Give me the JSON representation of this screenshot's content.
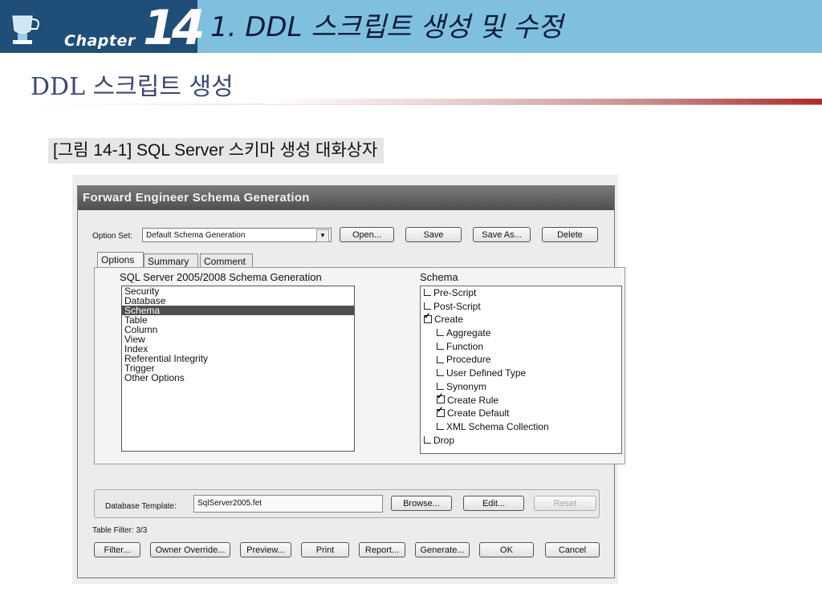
{
  "header": {
    "chapter_label": "Chapter",
    "chapter_number": "14",
    "title": "1. DDL 스크립트 생성 및 수정",
    "logo_icon": "trophy-icon"
  },
  "section_title": "DDL 스크립트 생성",
  "figure_caption": "[그림 14-1] SQL Server 스키마 생성 대화상자",
  "dialog": {
    "title": "Forward Engineer Schema Generation",
    "option_set_label": "Option Set:",
    "option_set_value": "Default Schema Generation",
    "buttons_top": [
      "Open...",
      "Save",
      "Save As...",
      "Delete"
    ],
    "tabs": [
      "Options",
      "Summary",
      "Comment"
    ],
    "active_tab": "Options",
    "left_heading": "SQL Server 2005/2008 Schema Generation",
    "left_items": [
      "Security",
      "Database",
      "Schema",
      "Table",
      "Column",
      "View",
      "Index",
      "Referential Integrity",
      "Trigger",
      "Other Options"
    ],
    "left_selected": "Schema",
    "right_heading": "Schema",
    "tree": [
      {
        "label": "Pre-Script",
        "checked": false,
        "level": 0
      },
      {
        "label": "Post-Script",
        "checked": false,
        "level": 0
      },
      {
        "label": "Create",
        "checked": true,
        "level": 0
      },
      {
        "label": "Aggregate",
        "checked": false,
        "level": 1
      },
      {
        "label": "Function",
        "checked": false,
        "level": 1
      },
      {
        "label": "Procedure",
        "checked": false,
        "level": 1
      },
      {
        "label": "User Defined Type",
        "checked": false,
        "level": 1
      },
      {
        "label": "Synonym",
        "checked": false,
        "level": 1
      },
      {
        "label": "Create Rule",
        "checked": true,
        "level": 1
      },
      {
        "label": "Create Default",
        "checked": true,
        "level": 1
      },
      {
        "label": "XML Schema Collection",
        "checked": false,
        "level": 1
      },
      {
        "label": "Drop",
        "checked": false,
        "level": 0
      }
    ],
    "template_label": "Database Template:",
    "template_value": "SqlServer2005.fet",
    "template_buttons": [
      "Browse...",
      "Edit...",
      "Reset"
    ],
    "table_filter": "Table Filter: 3/3",
    "bottom_buttons": [
      "Filter...",
      "Owner Override...",
      "Preview...",
      "Print",
      "Report...",
      "Generate...",
      "OK",
      "Cancel"
    ]
  }
}
